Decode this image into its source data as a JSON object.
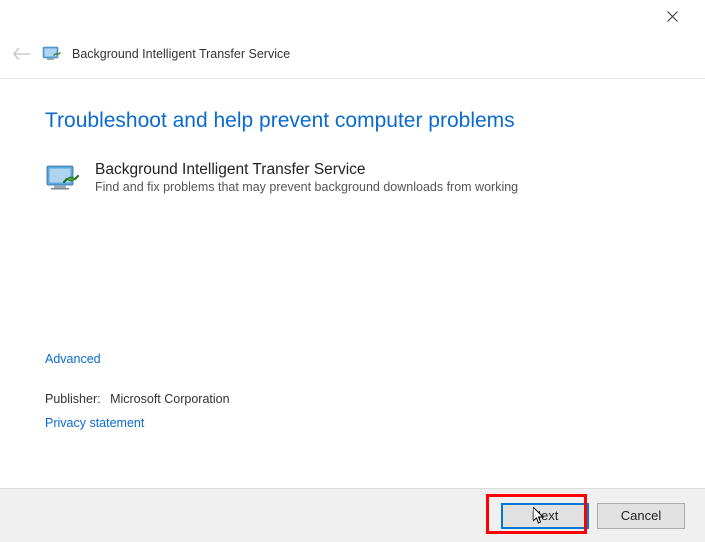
{
  "titlebar": {
    "close_icon": "close"
  },
  "header": {
    "title": "Background Intelligent Transfer Service"
  },
  "main": {
    "heading": "Troubleshoot and help prevent computer problems",
    "item": {
      "title": "Background Intelligent Transfer Service",
      "description": "Find and fix problems that may prevent background downloads from working"
    }
  },
  "links": {
    "advanced": "Advanced",
    "privacy": "Privacy statement"
  },
  "publisher": {
    "label": "Publisher:",
    "name": "Microsoft Corporation"
  },
  "footer": {
    "next": "Next",
    "cancel": "Cancel"
  }
}
